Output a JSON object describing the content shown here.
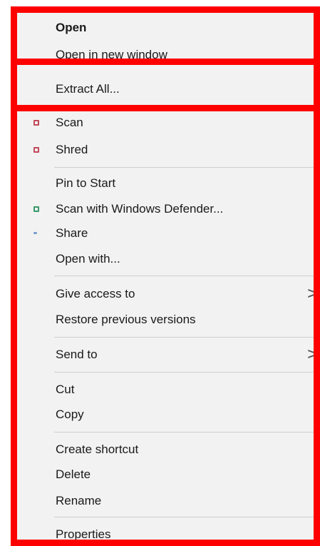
{
  "menu": {
    "open_label": "Open",
    "open_new_window_label": "Open in new window",
    "extract_all_label": "Extract All...",
    "scan_label": "Scan",
    "shred_label": "Shred",
    "pin_to_start_label": "Pin to Start",
    "scan_defender_label": "Scan with Windows Defender...",
    "share_label": "Share",
    "open_with_label": "Open with...",
    "give_access_label": "Give access to",
    "restore_versions_label": "Restore previous versions",
    "send_to_label": "Send to",
    "cut_label": "Cut",
    "copy_label": "Copy",
    "create_shortcut_label": "Create shortcut",
    "delete_label": "Delete",
    "rename_label": "Rename",
    "properties_label": "Properties",
    "submenu_arrow": ">"
  },
  "icons": {
    "scan": "scan-icon",
    "shred": "shred-icon",
    "defender": "defender-icon",
    "share": "share-icon"
  },
  "colors": {
    "highlight": "#ff0000",
    "menu_background": "#f2f2f2",
    "scan_icon": "#c24a5a",
    "defender_icon": "#3a9a6a",
    "share_icon": "#7a9acc"
  }
}
